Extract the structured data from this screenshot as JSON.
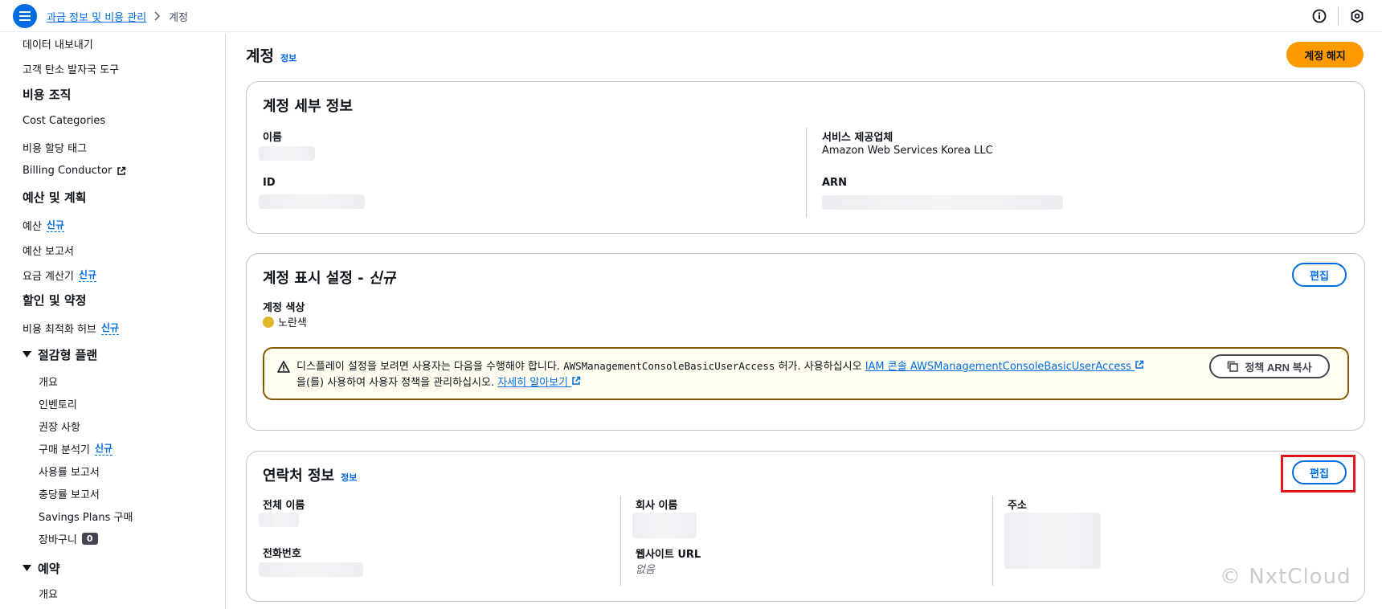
{
  "breadcrumb": {
    "parent": "과금 정보 및 비용 관리",
    "current": "계정"
  },
  "sidebar": {
    "items_top": [
      "데이터 내보내기",
      "고객 탄소 발자국 도구"
    ],
    "section_cost_org": "비용 조직",
    "cost_org_items": [
      "Cost Categories",
      "비용 할당 태그",
      "Billing Conductor"
    ],
    "section_budget": "예산 및 계획",
    "budget_items": [
      {
        "label": "예산",
        "tag": "신규"
      },
      {
        "label": "예산 보고서",
        "tag": ""
      },
      {
        "label": "요금 계산기",
        "tag": "신규"
      }
    ],
    "section_discount": "할인 및 약정",
    "discount_items": [
      {
        "label": "비용 최적화 허브",
        "tag": "신규"
      }
    ],
    "group_savings": "절감형 플랜",
    "savings_items": [
      {
        "label": "개요",
        "tag": ""
      },
      {
        "label": "인벤토리",
        "tag": ""
      },
      {
        "label": "권장 사항",
        "tag": ""
      },
      {
        "label": "구매 분석기",
        "tag": "신규"
      },
      {
        "label": "사용률 보고서",
        "tag": ""
      },
      {
        "label": "충당률 보고서",
        "tag": ""
      },
      {
        "label": "Savings Plans 구매",
        "tag": ""
      },
      {
        "label": "장바구니",
        "tag": ""
      }
    ],
    "cart_count": "0",
    "group_reservation": "예약",
    "reservation_items": [
      "개요"
    ]
  },
  "page": {
    "title": "계정",
    "info": "정보",
    "close_account": "계정 해지"
  },
  "account_details": {
    "title": "계정 세부 정보",
    "name_label": "이름",
    "id_label": "ID",
    "provider_label": "서비스 제공업체",
    "provider_value": "Amazon Web Services Korea LLC",
    "arn_label": "ARN"
  },
  "display_settings": {
    "title": "계정 표시 설정 - ",
    "title_em": "신규",
    "edit": "편집",
    "color_label": "계정 색상",
    "color_value": "노란색",
    "color_hex": "#e0b52c",
    "alert_text_1": "디스플레이 설정을 보려면 사용자는 다음을 수행해야 합니다. ",
    "alert_mono": "AWSManagementConsoleBasicUserAccess",
    "alert_text_2": " 허가. 사용하십시오 ",
    "alert_link_1": "IAM 콘솔 AWSManagementConsoleBasicUserAccess",
    "alert_text_3": " 을(를) 사용하여 사용자 정책을 관리하십시오. ",
    "alert_link_2": "자세히 알아보기",
    "copy_button": "정책 ARN 복사"
  },
  "contact": {
    "title": "연락처 정보",
    "info": "정보",
    "edit": "편집",
    "full_name_label": "전체 이름",
    "phone_label": "전화번호",
    "company_label": "회사 이름",
    "website_label": "웹사이트 URL",
    "website_value": "없음",
    "address_label": "주소"
  },
  "watermark": "© NxtCloud",
  "colors": {
    "primary": "#006ce0",
    "accent": "#ff9900",
    "highlight": "#e3151d"
  }
}
